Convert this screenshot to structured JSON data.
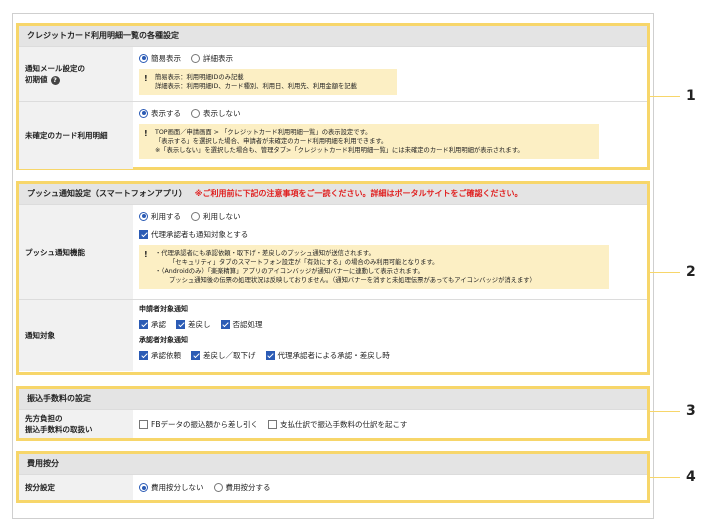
{
  "section1": {
    "title": "クレジットカード利用明細一覧の各種設定",
    "rows": [
      {
        "label_lines": [
          "通知メール設定の",
          "初期値"
        ],
        "options": [
          "簡易表示",
          "詳細表示"
        ],
        "selected": 0,
        "note": [
          "簡易表示：利用明細IDのみ記載",
          "詳細表示：利用明細ID、カード種別、利用日、利用先、利用金額を記載"
        ]
      },
      {
        "label": "未確定のカード利用明細",
        "options": [
          "表示する",
          "表示しない"
        ],
        "selected": 0,
        "note": [
          "TOP画面／申請画面 > 「クレジットカード利用明細一覧」の表示設定です。",
          "「表示する」を選択した場合、申請者が未確定のカード利用明細を利用できます。",
          "※「表示しない」を選択した場合も、管理タブ>「クレジットカード利用明細一覧」には未確定のカード利用明細が表示されます。"
        ]
      }
    ]
  },
  "section2": {
    "title": "プッシュ通知設定（スマートフォンアプリ）",
    "warning": "※ご利用前に下記の注意事項をご一読ください。詳細はポータルサイトをご確認ください。",
    "rows": [
      {
        "label": "プッシュ通知機能",
        "options": [
          "利用する",
          "利用しない"
        ],
        "selected": 0,
        "checkbox": "代理承認者も通知対象とする",
        "note": [
          "・代理承認者にも承認依頼・取下げ・差戻しのプッシュ通知が送信されます。",
          "「セキュリティ」タブのスマートフォン設定が「有効にする」の場合のみ利用可能となります。",
          "・（Androidのみ）「楽楽精算」アプリのアイコンバッジが通知バナーに連動して表示されます。",
          "プッシュ通知後の伝票の処理状況は反映しておりません。（通知バナーを消すと未処理伝票があってもアイコンバッジが消えます）"
        ]
      },
      {
        "label": "通知対象",
        "applicant_head": "申請者対象通知",
        "applicant_items": [
          "承認",
          "差戻し",
          "否認処理"
        ],
        "approver_head": "承認者対象通知",
        "approver_items": [
          "承認依頼",
          "差戻し／取下げ",
          "代理承認者による承認・差戻し時"
        ]
      }
    ]
  },
  "section3": {
    "title": "振込手数料の設定",
    "label_lines": [
      "先方負担の",
      "振込手数料の取扱い"
    ],
    "checkboxes": [
      "FBデータの振込額から差し引く",
      "支払仕訳で振込手数料の仕訳を起こす"
    ]
  },
  "section4": {
    "title": "費用按分",
    "label": "按分設定",
    "options": [
      "費用按分しない",
      "費用按分する"
    ],
    "selected": 0
  },
  "callouts": [
    "1",
    "2",
    "3",
    "4"
  ]
}
